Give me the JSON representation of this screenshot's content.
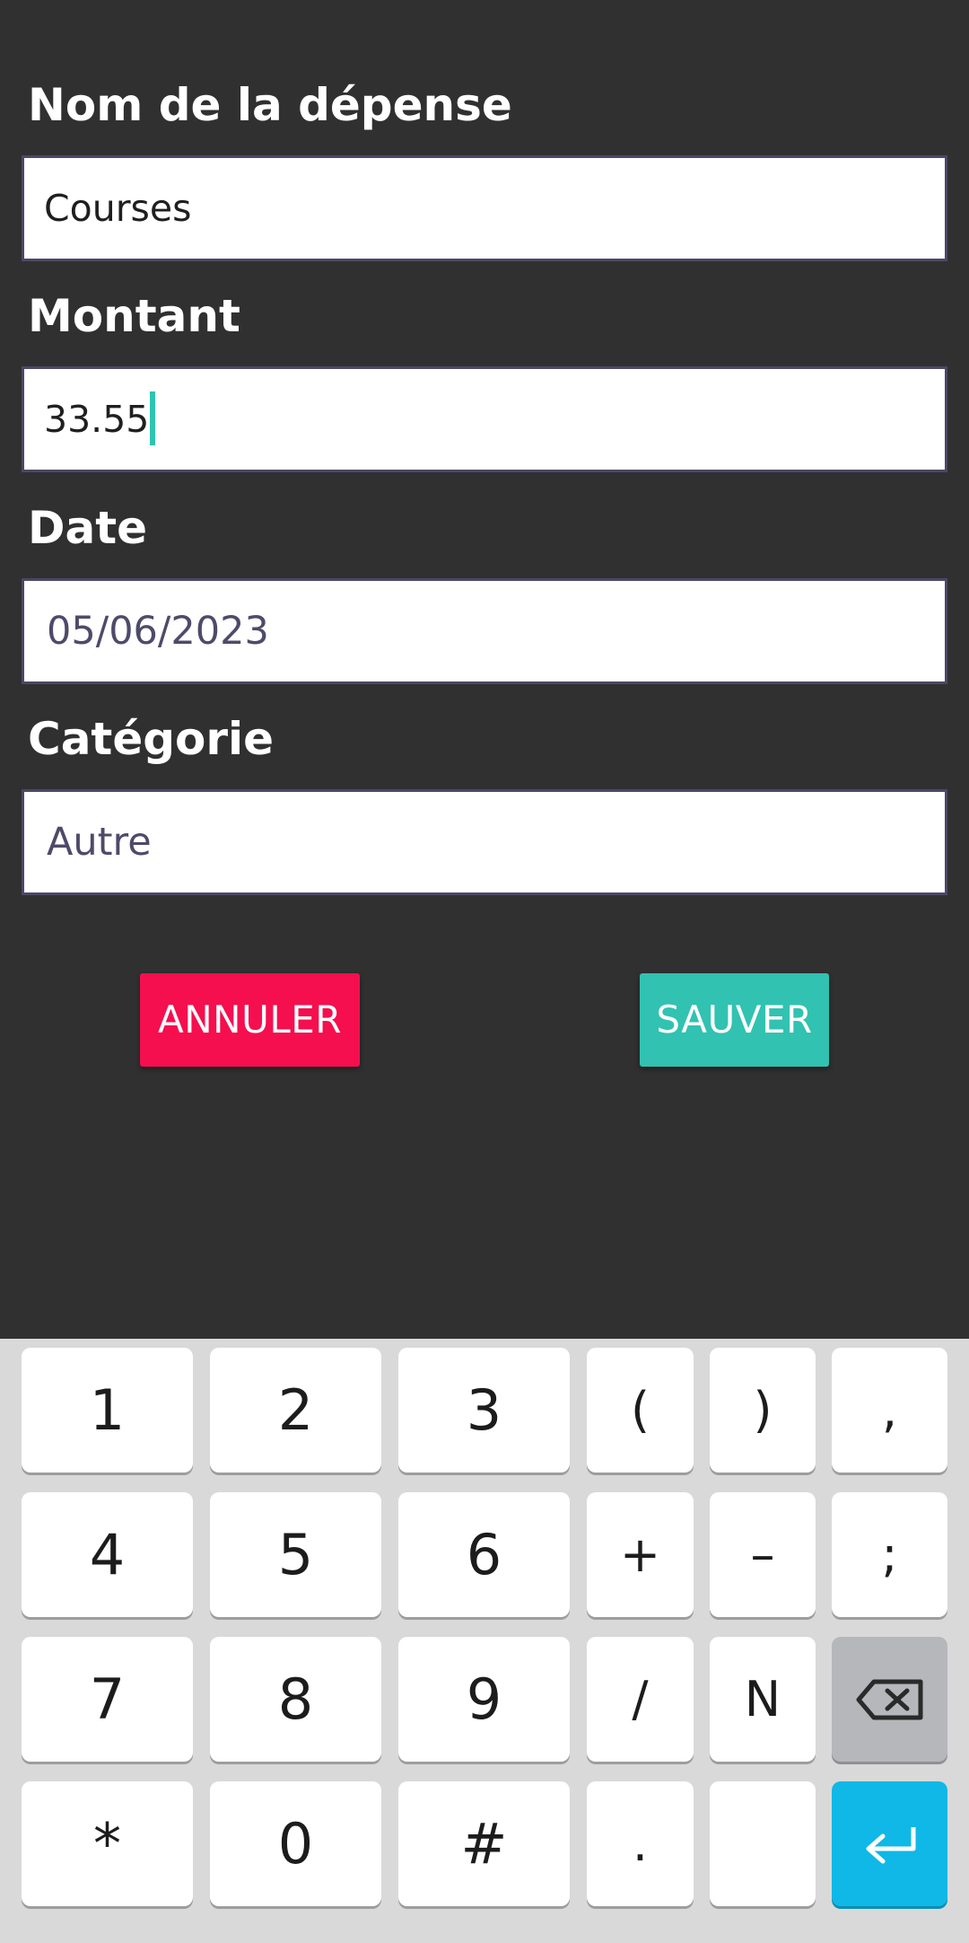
{
  "form": {
    "name_label": "Nom de la dépense",
    "name_value": "Courses",
    "amount_label": "Montant",
    "amount_value": "33.55",
    "date_label": "Date",
    "date_value": "05/06/2023",
    "category_label": "Catégorie",
    "category_value": "Autre"
  },
  "buttons": {
    "cancel_label": "ANNULER",
    "save_label": "SAUVER"
  },
  "keyboard": {
    "rows": [
      [
        "1",
        "2",
        "3",
        "(",
        ")",
        ","
      ],
      [
        "4",
        "5",
        "6",
        "+",
        "–",
        ";"
      ],
      [
        "7",
        "8",
        "9",
        "/",
        "N",
        "backspace-icon"
      ],
      [
        "*",
        "0",
        "#",
        ".",
        "",
        "enter-icon"
      ]
    ]
  },
  "colors": {
    "background": "#313031",
    "cancel": "#f50f4f",
    "save": "#31c2b1",
    "enter_key": "#0fb8e6",
    "caret": "#2ec4b1"
  }
}
